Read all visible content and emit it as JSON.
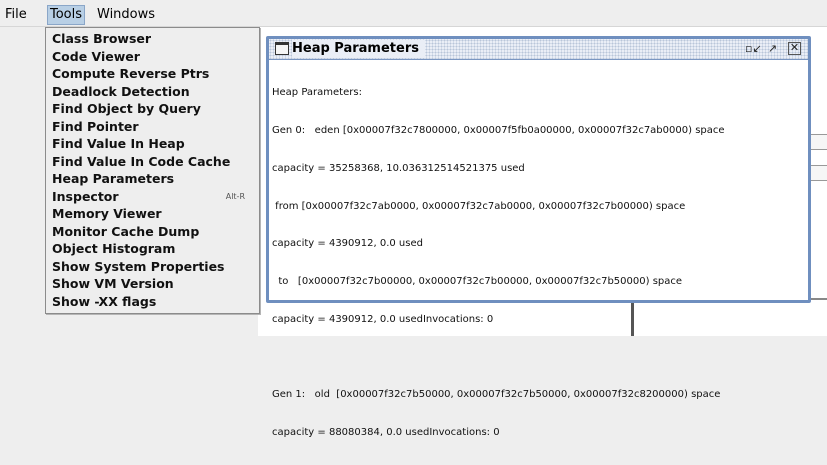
{
  "menubar": {
    "file": "File",
    "tools": "Tools",
    "windows": "Windows"
  },
  "tools_menu": {
    "items": [
      {
        "label": "Class Browser"
      },
      {
        "label": "Code Viewer"
      },
      {
        "label": "Compute Reverse Ptrs"
      },
      {
        "label": "Deadlock Detection"
      },
      {
        "label": "Find Object by Query"
      },
      {
        "label": "Find Pointer"
      },
      {
        "label": "Find Value In Heap"
      },
      {
        "label": "Find Value In Code Cache"
      },
      {
        "label": "Heap Parameters"
      },
      {
        "label": "Inspector",
        "accelerator": "Alt-R"
      },
      {
        "label": "Memory Viewer"
      },
      {
        "label": "Monitor Cache Dump"
      },
      {
        "label": "Object Histogram"
      },
      {
        "label": "Show System Properties"
      },
      {
        "label": "Show VM Version"
      },
      {
        "label": "Show -XX flags"
      }
    ]
  },
  "heap_window": {
    "title": "Heap Parameters",
    "buttons": {
      "minimize": "▫↙",
      "maximize": "↗",
      "close": "✕"
    },
    "lines": [
      "Heap Parameters:",
      "Gen 0:   eden [0x00007f32c7800000, 0x00007f5fb0a00000, 0x00007f32c7ab0000) space",
      "capacity = 35258368, 10.036312514521375 used",
      " from [0x00007f32c7ab0000, 0x00007f32c7ab0000, 0x00007f32c7b00000) space",
      "capacity = 4390912, 0.0 used",
      "  to   [0x00007f32c7b00000, 0x00007f32c7b00000, 0x00007f32c7b50000) space",
      "capacity = 4390912, 0.0 usedInvocations: 0",
      "",
      "Gen 1:   old  [0x00007f32c7b50000, 0x00007f32c7b50000, 0x00007f32c8200000) space",
      "capacity = 88080384, 0.0 usedInvocations: 0"
    ]
  }
}
